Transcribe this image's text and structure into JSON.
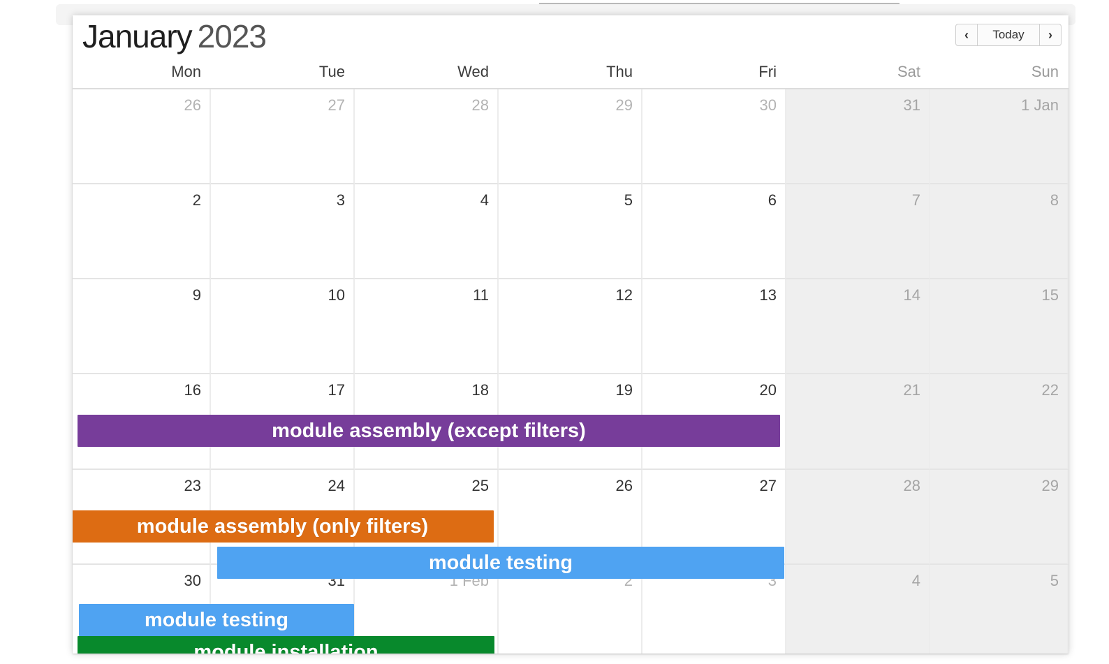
{
  "header": {
    "month": "January",
    "year": "2023",
    "prev_icon": "chevron-left-icon",
    "next_icon": "chevron-right-icon",
    "today_label": "Today"
  },
  "weekdays": [
    "Mon",
    "Tue",
    "Wed",
    "Thu",
    "Fri",
    "Sat",
    "Sun"
  ],
  "weeks": [
    [
      {
        "label": "26",
        "muted": true
      },
      {
        "label": "27",
        "muted": true
      },
      {
        "label": "28",
        "muted": true
      },
      {
        "label": "29",
        "muted": true
      },
      {
        "label": "30",
        "muted": true
      },
      {
        "label": "31",
        "muted": true
      },
      {
        "label": "1 Jan",
        "muted": false
      }
    ],
    [
      {
        "label": "2"
      },
      {
        "label": "3"
      },
      {
        "label": "4"
      },
      {
        "label": "5"
      },
      {
        "label": "6"
      },
      {
        "label": "7"
      },
      {
        "label": "8"
      }
    ],
    [
      {
        "label": "9"
      },
      {
        "label": "10"
      },
      {
        "label": "11"
      },
      {
        "label": "12"
      },
      {
        "label": "13"
      },
      {
        "label": "14"
      },
      {
        "label": "15"
      }
    ],
    [
      {
        "label": "16"
      },
      {
        "label": "17"
      },
      {
        "label": "18"
      },
      {
        "label": "19"
      },
      {
        "label": "20"
      },
      {
        "label": "21"
      },
      {
        "label": "22"
      }
    ],
    [
      {
        "label": "23"
      },
      {
        "label": "24"
      },
      {
        "label": "25"
      },
      {
        "label": "26"
      },
      {
        "label": "27"
      },
      {
        "label": "28"
      },
      {
        "label": "29"
      }
    ],
    [
      {
        "label": "30"
      },
      {
        "label": "31"
      },
      {
        "label": "1 Feb",
        "muted": true
      },
      {
        "label": "2",
        "muted": true
      },
      {
        "label": "3",
        "muted": true
      },
      {
        "label": "4",
        "muted": true
      },
      {
        "label": "5",
        "muted": true
      }
    ]
  ],
  "events": [
    {
      "title": "module assembly (except filters)",
      "color": "#773d9a"
    },
    {
      "title": "module assembly (only filters)",
      "color": "#dd6c13"
    },
    {
      "title": "module testing",
      "color": "#4fa3f2"
    },
    {
      "title": "module testing",
      "color": "#4fa3f2"
    },
    {
      "title": "module installation",
      "color": "#08892c"
    }
  ]
}
